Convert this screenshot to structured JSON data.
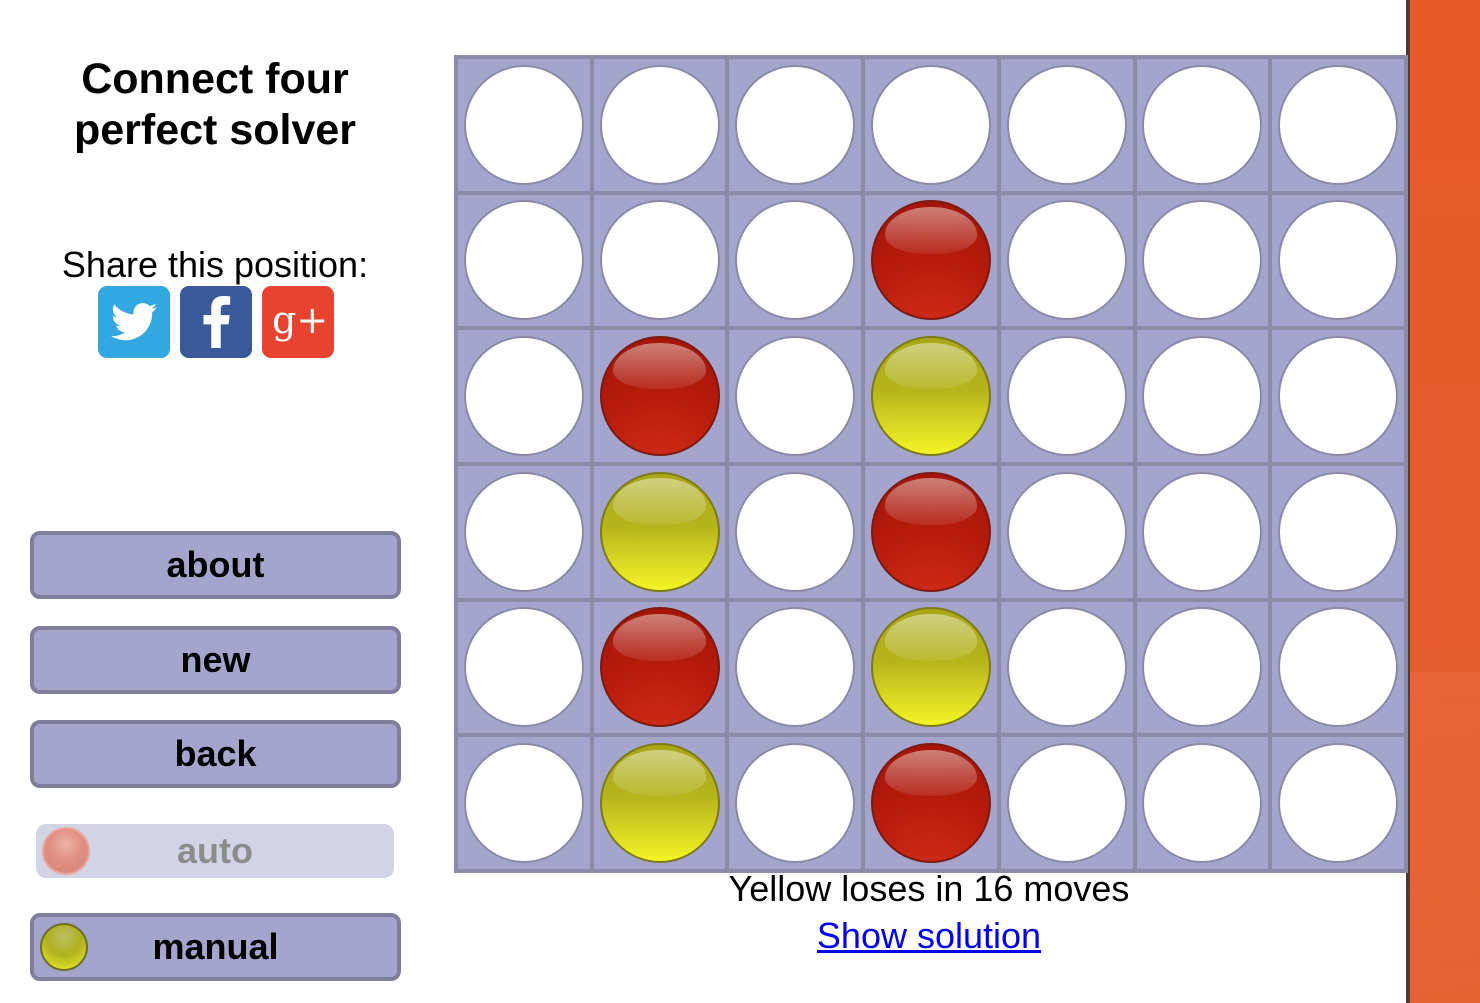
{
  "sidebar": {
    "title_line1": "Connect four",
    "title_line2": "perfect solver",
    "share_label": "Share this position:",
    "share": [
      {
        "icon": "twitter-icon",
        "color": "#33a8e0"
      },
      {
        "icon": "facebook-icon",
        "color": "#3b5998"
      },
      {
        "icon": "google-plus-icon",
        "color": "#e7432f",
        "glyph": "g+"
      }
    ],
    "buttons": {
      "about": "about",
      "new": "new",
      "back": "back",
      "auto": "auto",
      "manual": "manual"
    }
  },
  "board": {
    "columns": 7,
    "rows": 6,
    "cells": [
      [
        "empty",
        "empty",
        "empty",
        "empty",
        "empty",
        "empty",
        "empty"
      ],
      [
        "empty",
        "empty",
        "empty",
        "red",
        "empty",
        "empty",
        "empty"
      ],
      [
        "empty",
        "red",
        "empty",
        "yellow",
        "empty",
        "empty",
        "empty"
      ],
      [
        "empty",
        "yellow",
        "empty",
        "red",
        "empty",
        "empty",
        "empty"
      ],
      [
        "empty",
        "red",
        "empty",
        "yellow",
        "empty",
        "empty",
        "empty"
      ],
      [
        "empty",
        "yellow",
        "empty",
        "red",
        "empty",
        "empty",
        "empty"
      ]
    ],
    "colors": {
      "frame": "#a5a4cc",
      "red": "#b71b0c",
      "yellow": "#f4f426"
    }
  },
  "status": {
    "message": "Yellow loses in 16 moves",
    "solution_link": "Show solution"
  }
}
